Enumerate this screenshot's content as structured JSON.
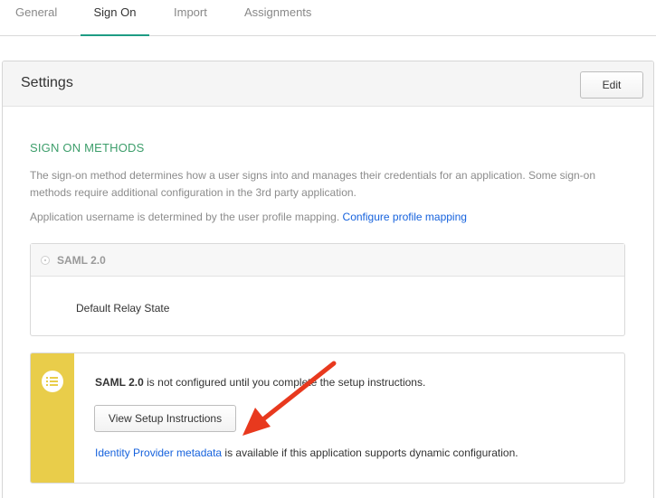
{
  "tabs": [
    {
      "label": "General"
    },
    {
      "label": "Sign On",
      "active": true
    },
    {
      "label": "Import"
    },
    {
      "label": "Assignments"
    }
  ],
  "settings": {
    "title": "Settings",
    "edit_label": "Edit"
  },
  "sign_on": {
    "section_title": "SIGN ON METHODS",
    "description": "The sign-on method determines how a user signs into and manages their credentials for an application. Some sign-on methods require additional configuration in the 3rd party application.",
    "mapping_text": "Application username is determined by the user profile mapping.",
    "mapping_link": "Configure profile mapping"
  },
  "saml": {
    "option_label": "SAML 2.0",
    "relay_state_label": "Default Relay State"
  },
  "notice": {
    "strong_text": "SAML 2.0",
    "text": "is not configured until you complete the setup instructions.",
    "button_label": "View Setup Instructions",
    "metadata_link": "Identity Provider metadata",
    "metadata_text": "is available if this application supports dynamic configuration."
  },
  "colors": {
    "accent_green": "#3d9e6b",
    "tab_underline": "#1e9c84",
    "link_blue": "#1662dd",
    "notice_yellow": "#e9cd4a",
    "arrow_red": "#e8391e"
  },
  "icons": {
    "notice": "list-icon",
    "radio": "radio-icon",
    "annotation": "red-arrow-icon"
  }
}
